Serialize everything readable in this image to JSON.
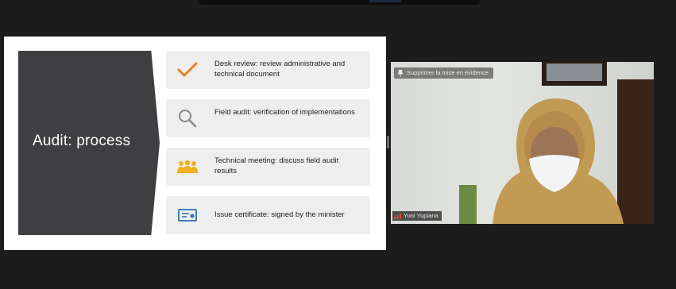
{
  "slide": {
    "title": "Audit: process",
    "steps": [
      {
        "icon": "checkmark-icon",
        "text": "Desk review: review administrative and technical document"
      },
      {
        "icon": "magnifier-icon",
        "text": "Field audit: verification of implementations"
      },
      {
        "icon": "people-group-icon",
        "text": "Technical meeting: discuss field audit results"
      },
      {
        "icon": "certificate-icon",
        "text": "Issue certificate: signed by the minister"
      }
    ]
  },
  "video": {
    "remove_spotlight_label": "Supprimer la mise en évidence",
    "participant_name": "Yuni Yupiana"
  },
  "colors": {
    "background": "#1c1c1c",
    "title_panel": "#3f3e40",
    "card": "#efeeef",
    "check_orange": "#e8811f",
    "icon_gold": "#f0b120",
    "icon_blue": "#2e6db4"
  }
}
